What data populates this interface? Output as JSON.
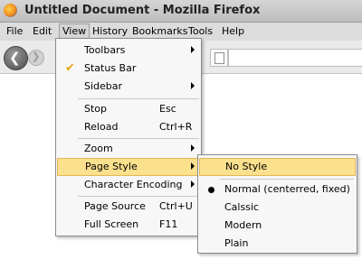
{
  "window": {
    "title": "Untitled Document - Mozilla Firefox"
  },
  "menubar": {
    "items": [
      "File",
      "Edit",
      "View",
      "History",
      "Bookmarks",
      "Tools",
      "Help"
    ],
    "active": "View"
  },
  "view_menu": {
    "items": [
      {
        "label": "Toolbars",
        "shortcut": "",
        "submenu": true,
        "checked": false
      },
      {
        "label": "Status Bar",
        "shortcut": "",
        "submenu": false,
        "checked": true
      },
      {
        "label": "Sidebar",
        "shortcut": "",
        "submenu": true,
        "checked": false
      },
      {
        "label": "Stop",
        "shortcut": "Esc",
        "submenu": false,
        "checked": false
      },
      {
        "label": "Reload",
        "shortcut": "Ctrl+R",
        "submenu": false,
        "checked": false
      },
      {
        "label": "Zoom",
        "shortcut": "",
        "submenu": true,
        "checked": false
      },
      {
        "label": "Page Style",
        "shortcut": "",
        "submenu": true,
        "checked": false,
        "highlighted": true
      },
      {
        "label": "Character Encoding",
        "shortcut": "",
        "submenu": true,
        "checked": false
      },
      {
        "label": "Page Source",
        "shortcut": "Ctrl+U",
        "submenu": false,
        "checked": false
      },
      {
        "label": "Full Screen",
        "shortcut": "F11",
        "submenu": false,
        "checked": false
      }
    ]
  },
  "page_style_menu": {
    "items": [
      {
        "label": "No Style",
        "selected": false,
        "highlighted": true
      },
      {
        "label": "Normal (centerred, fixed)",
        "selected": true
      },
      {
        "label": "Calssic",
        "selected": false
      },
      {
        "label": "Modern",
        "selected": false
      },
      {
        "label": "Plain",
        "selected": false
      }
    ]
  },
  "icons": {
    "app": "firefox-icon",
    "back": "back-arrow-icon",
    "forward": "forward-arrow-icon",
    "page": "page-icon"
  },
  "colors": {
    "highlight": "#fbe08d",
    "highlight_border": "#e3b755",
    "checkmark": "#e8a617"
  }
}
